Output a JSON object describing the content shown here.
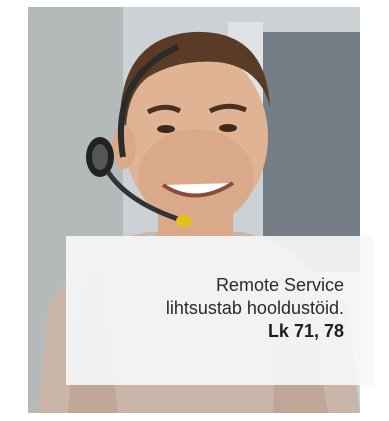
{
  "photo": {
    "subject": "person-with-headset-image"
  },
  "caption": {
    "line1": "Remote Service",
    "line2": "lihtsustab hooldustöid.",
    "reference": "Lk 71, 78"
  },
  "colors": {
    "caption_background": "#f6f7f8",
    "caption_text": "#2a2a2a"
  }
}
